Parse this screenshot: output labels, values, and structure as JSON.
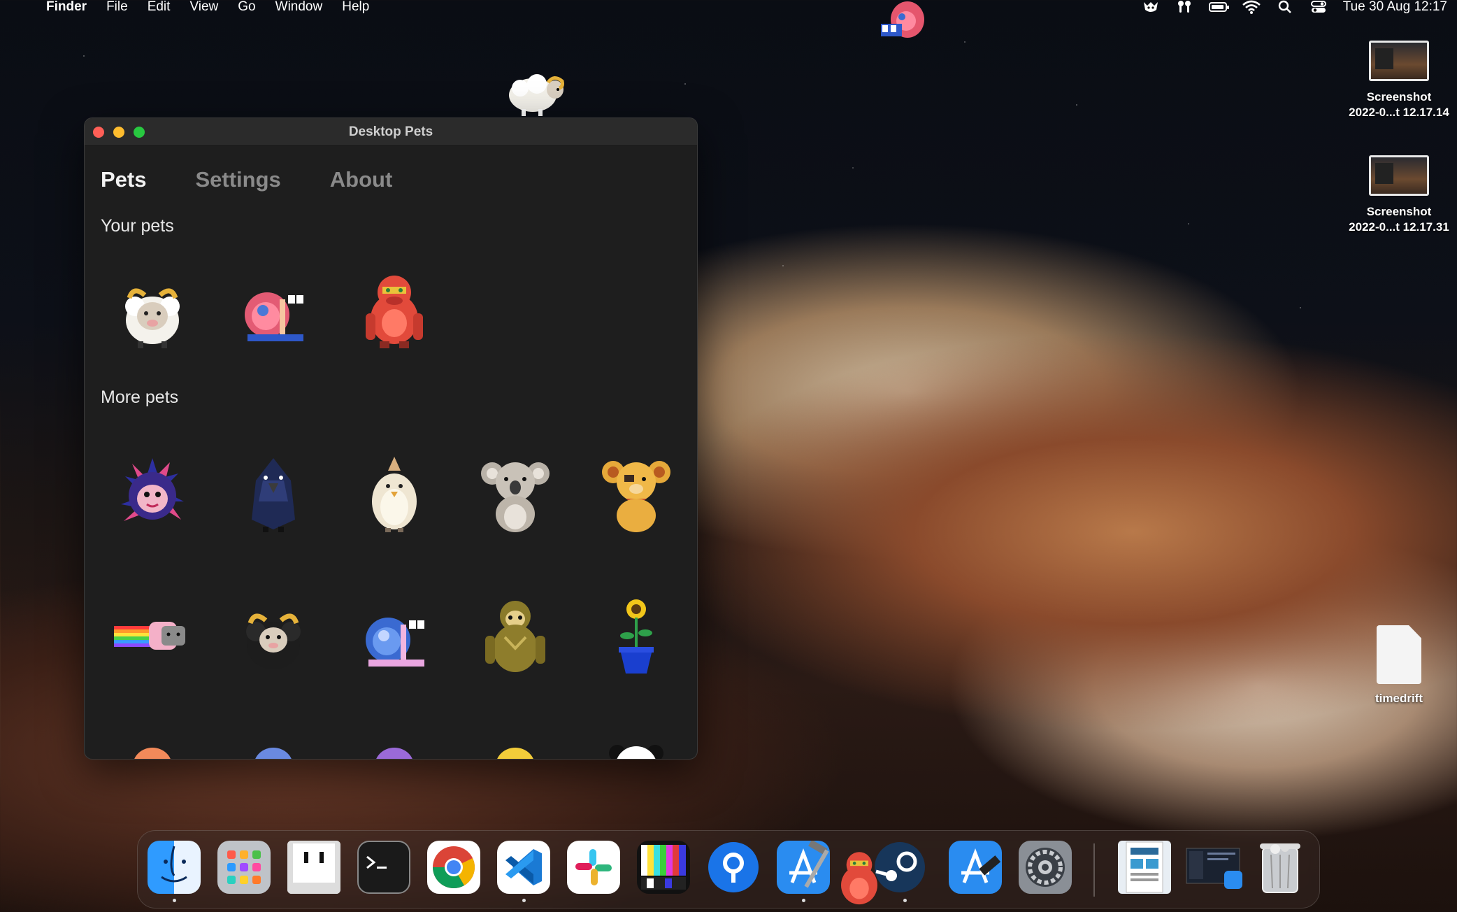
{
  "menubar": {
    "app_name": "Finder",
    "menus": [
      "File",
      "Edit",
      "View",
      "Go",
      "Window",
      "Help"
    ],
    "datetime": "Tue 30 Aug  12:17",
    "battery_level": 0.75
  },
  "window": {
    "title": "Desktop Pets",
    "tabs": [
      "Pets",
      "Settings",
      "About"
    ],
    "active_tab": "Pets",
    "your_pets_label": "Your pets",
    "more_pets_label": "More pets",
    "your_pets": [
      "sheep",
      "snail",
      "red-ape"
    ],
    "more_pets": [
      "punk-hedgehog",
      "crow",
      "chick",
      "koala",
      "bear",
      "nyan-cat",
      "black-sheep",
      "blue-snail",
      "sloth",
      "sunflower",
      "orange-frog",
      "blue-frog",
      "purple-frog",
      "yellow-frog",
      "panda"
    ]
  },
  "desktop": {
    "files": [
      {
        "name": "Screenshot",
        "sub": "2022-0...t 12.17.14"
      },
      {
        "name": "Screenshot",
        "sub": "2022-0...t 12.17.31"
      },
      {
        "name": "timedrift"
      }
    ]
  },
  "dock": {
    "apps": [
      "finder",
      "launchpad",
      "screen-tool",
      "terminal",
      "chrome",
      "vscode",
      "slack",
      "colors",
      "pin-app",
      "xcode",
      "steam",
      "app-store",
      "system-preferences"
    ],
    "documents": [
      "document-stack",
      "screenshot-stack"
    ],
    "trash": "trash"
  },
  "colors": {
    "close": "#ff5f57",
    "minimize": "#febc2e",
    "maximize": "#28c840"
  }
}
